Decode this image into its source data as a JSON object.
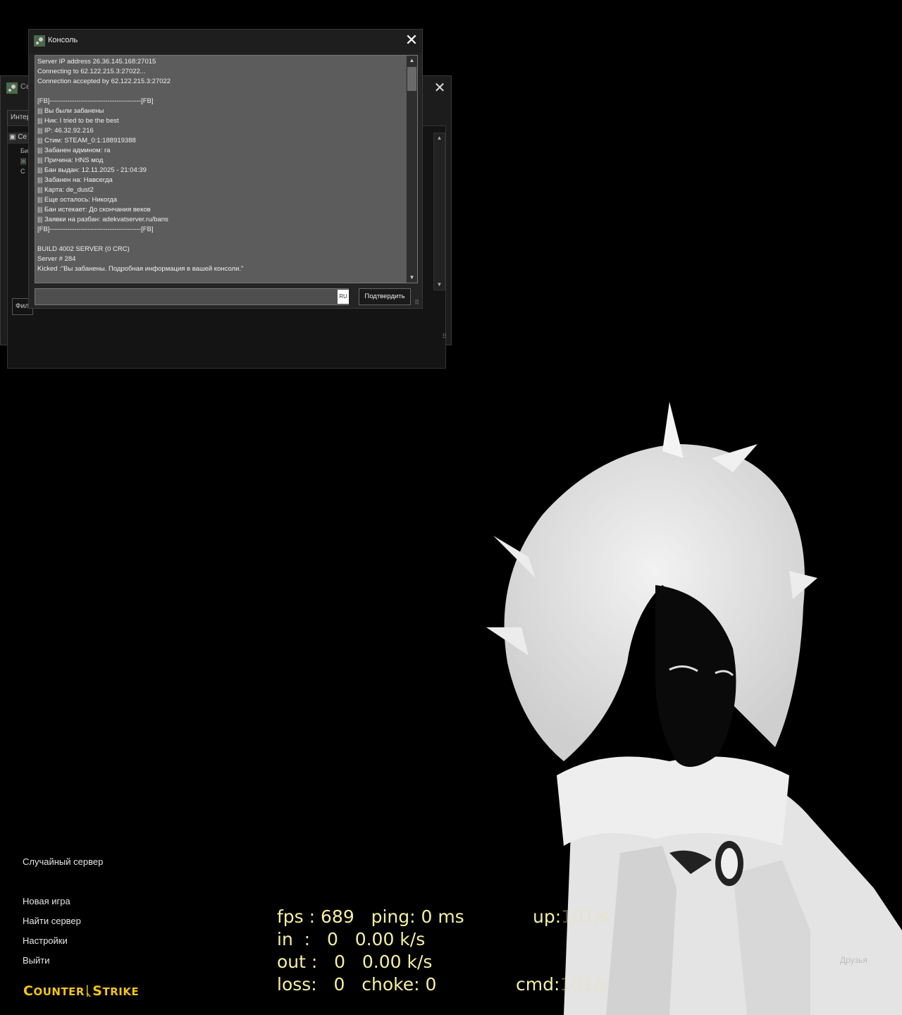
{
  "background": {
    "icon": "hooded-character-art"
  },
  "back_window": {
    "title": "Се",
    "tab_label": "Интер",
    "list_header": "Се",
    "rows": [
      "Би",
      "Ж",
      "С"
    ],
    "filter_label": "Фил"
  },
  "console": {
    "title": "Консоль",
    "lines": [
      "Server IP address 26.36.145.168:27015",
      "Connecting to 62.122.215.3:27022...",
      "Connection accepted by 62.122.215.3:27022",
      "",
      "[FB]-----------------------------------------[FB]",
      "||| Вы были забанены",
      "||| Ник: I tried to be the best",
      "||| IP: 46.32.92.216",
      "||| Стим: STEAM_0:1:188919388",
      "||| Забанен админом: ra",
      "||| Причина: HNS мод",
      "||| Бан выдан: 12.11.2025 - 21:04:39",
      "||| Забанен на: Навсегда",
      "||| Карта: de_dust2",
      "||| Еще осталось: Никогда",
      "||| Бан истекает: До скончания веков",
      "||| Заявки на разбан: adekvatserver.ru/bans",
      "[FB]-----------------------------------------[FB]",
      "",
      "BUILD 4002 SERVER (0 CRC)",
      "Server # 284",
      "Kicked :\"Вы забанены. Подробная информация в вашей консоли.\""
    ],
    "input_value": "",
    "language": "RU",
    "submit_label": "Подтвердить"
  },
  "menu": {
    "random_server": "Случайный сервер",
    "new_game": "Новая игра",
    "find_server": "Найти сервер",
    "settings": "Настройки",
    "quit": "Выйти"
  },
  "logo": {
    "part1_big": "C",
    "part1_small": "OUNTER",
    "part2_big": "S",
    "part2_small": "TRIKE"
  },
  "netgraph": {
    "line1": "fps : 689   ping: 0 ms",
    "line2": "in  :   0   0.00 k/s",
    "line3": "out :   0   0.00 k/s",
    "line4": "loss:   0   choke: 0",
    "up_label": "up:",
    "up_value": "101/s",
    "cmd_label": "cmd:",
    "cmd_value": "101/s"
  },
  "friends_label": "Друзья"
}
